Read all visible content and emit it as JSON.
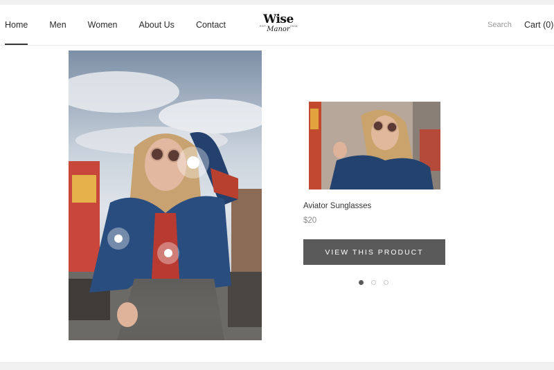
{
  "nav": {
    "items": [
      {
        "label": "Home",
        "active": true
      },
      {
        "label": "Men"
      },
      {
        "label": "Women"
      },
      {
        "label": "About Us"
      },
      {
        "label": "Contact"
      }
    ]
  },
  "logo": {
    "top": "Wise",
    "bottom": "Manor",
    "est": "EST.",
    "year": "2008"
  },
  "header": {
    "search_label": "Search",
    "cart_label": "Cart (0)"
  },
  "lookbook": {
    "hotspot_count": 3,
    "active_slide": 1,
    "slide_count": 3
  },
  "product": {
    "name": "Aviator Sunglasses",
    "price": "$20",
    "button_label": "VIEW THIS PRODUCT"
  },
  "colors": {
    "button_bg": "#5a5a5a",
    "dot_active": "#5a5a5a"
  },
  "icons": {
    "hotspot": "hotspot-icon",
    "carousel_dot": "carousel-dot-icon"
  }
}
